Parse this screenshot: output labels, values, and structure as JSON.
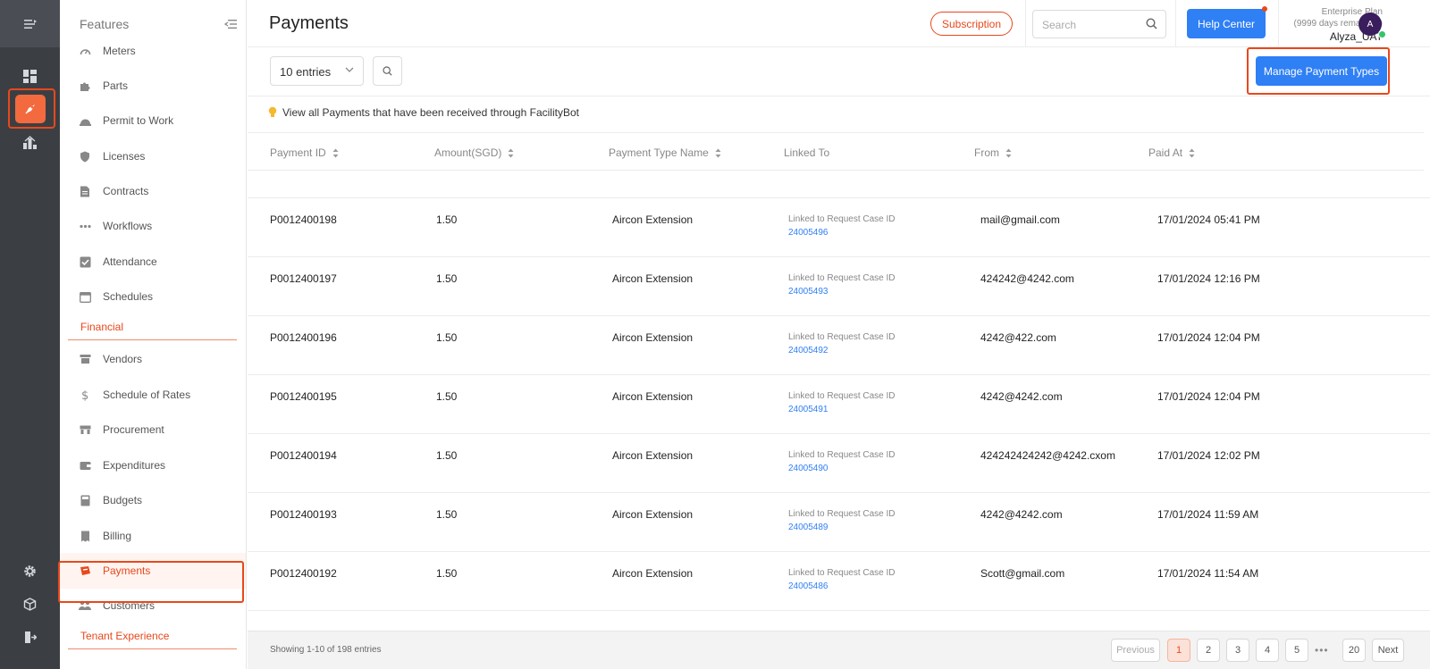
{
  "rail": {
    "menu_icon": "collapse-menu-icon",
    "items": [
      "dashboard-icon",
      "features-icon",
      "analytics-icon"
    ],
    "bottom_items": [
      "settings-icon",
      "cube-icon",
      "logout-icon"
    ]
  },
  "sidebar": {
    "title": "Features",
    "items": [
      {
        "label": "Meters",
        "icon": "gauge-icon"
      },
      {
        "label": "Parts",
        "icon": "puzzle-icon"
      },
      {
        "label": "Permit to Work",
        "icon": "hardhat-icon"
      },
      {
        "label": "Licenses",
        "icon": "shield-icon"
      },
      {
        "label": "Contracts",
        "icon": "document-icon"
      },
      {
        "label": "Workflows",
        "icon": "workflow-icon"
      },
      {
        "label": "Attendance",
        "icon": "checkbox-icon"
      },
      {
        "label": "Schedules",
        "icon": "calendar-icon"
      }
    ],
    "section_financial": "Financial",
    "financial_items": [
      {
        "label": "Vendors",
        "icon": "store-icon"
      },
      {
        "label": "Schedule of Rates",
        "icon": "dollar-icon"
      },
      {
        "label": "Procurement",
        "icon": "truck-icon"
      },
      {
        "label": "Expenditures",
        "icon": "wallet-icon"
      },
      {
        "label": "Budgets",
        "icon": "calculator-icon"
      },
      {
        "label": "Billing",
        "icon": "receipt-icon"
      },
      {
        "label": "Payments",
        "icon": "payment-icon"
      },
      {
        "label": "Customers",
        "icon": "people-icon"
      }
    ],
    "section_tenant": "Tenant Experience"
  },
  "header": {
    "title": "Payments",
    "subscription_label": "Subscription",
    "search_placeholder": "Search",
    "help_label": "Help Center",
    "plan_line1": "Enterprise Plan",
    "plan_line2": "(9999 days remaining)",
    "user_name": "Alyza_UAT",
    "avatar_initial": "A"
  },
  "toolbar": {
    "entries_label": "10 entries",
    "manage_label": "Manage Payment Types"
  },
  "info_text": "View all Payments that have been received through FacilityBot",
  "table": {
    "columns": [
      "Payment ID",
      "Amount(SGD)",
      "Payment Type Name",
      "Linked To",
      "From",
      "Paid At"
    ],
    "link_caption": "Linked to Request Case ID",
    "rows": [
      {
        "id": "P0012400198",
        "amount": "1.50",
        "type": "Aircon Extension",
        "link": "24005496",
        "from": "mail@gmail.com",
        "paid": "17/01/2024 05:41 PM"
      },
      {
        "id": "P0012400197",
        "amount": "1.50",
        "type": "Aircon Extension",
        "link": "24005493",
        "from": "424242@4242.com",
        "paid": "17/01/2024 12:16 PM"
      },
      {
        "id": "P0012400196",
        "amount": "1.50",
        "type": "Aircon Extension",
        "link": "24005492",
        "from": "4242@422.com",
        "paid": "17/01/2024 12:04 PM"
      },
      {
        "id": "P0012400195",
        "amount": "1.50",
        "type": "Aircon Extension",
        "link": "24005491",
        "from": "4242@4242.com",
        "paid": "17/01/2024 12:04 PM"
      },
      {
        "id": "P0012400194",
        "amount": "1.50",
        "type": "Aircon Extension",
        "link": "24005490",
        "from": "424242424242@4242.cxom",
        "paid": "17/01/2024 12:02 PM"
      },
      {
        "id": "P0012400193",
        "amount": "1.50",
        "type": "Aircon Extension",
        "link": "24005489",
        "from": "4242@4242.com",
        "paid": "17/01/2024 11:59 AM"
      },
      {
        "id": "P0012400192",
        "amount": "1.50",
        "type": "Aircon Extension",
        "link": "24005486",
        "from": "Scott@gmail.com",
        "paid": "17/01/2024 11:54 AM"
      }
    ]
  },
  "footer": {
    "showing": "Showing 1-10 of 198 entries",
    "previous": "Previous",
    "pages": [
      "1",
      "2",
      "3",
      "4",
      "5"
    ],
    "ellipsis": "•••",
    "last_page": "20",
    "next": "Next"
  },
  "colors": {
    "accent": "#e8481c",
    "primary": "#2f7ff5",
    "rail": "#3b3f44"
  }
}
